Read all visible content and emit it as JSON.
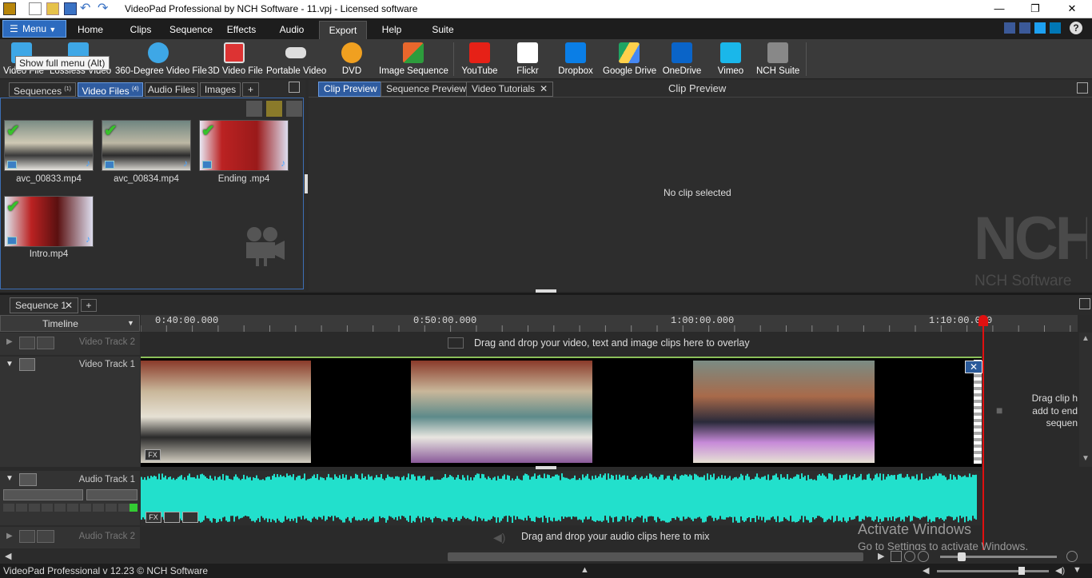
{
  "window": {
    "title": "VideoPad Professional by NCH Software - 11.vpj - Licensed software",
    "minimize": "—",
    "maximize": "❐",
    "close": "✕"
  },
  "menu": {
    "menu_button": "Menu",
    "tabs": [
      "Home",
      "Clips",
      "Sequence",
      "Effects",
      "Audio",
      "Export",
      "Help",
      "Suite"
    ],
    "active_tab": "Export"
  },
  "toolbar": {
    "tooltip": "Show full menu (Alt)",
    "items": [
      {
        "label": "Video File",
        "icon": "video-file-icon",
        "color": "#3ea7e6"
      },
      {
        "label": "Lossless Video",
        "icon": "lossless-video-icon",
        "color": "#3ea7e6"
      },
      {
        "label": "360-Degree Video File",
        "icon": "360-video-icon",
        "color": "#3ea7e6"
      },
      {
        "label": "3D Video File",
        "icon": "3d-video-icon",
        "color": "#d33"
      },
      {
        "label": "Portable Video",
        "icon": "portable-video-icon",
        "color": "#ddd"
      },
      {
        "label": "DVD",
        "icon": "dvd-icon",
        "color": "#f0a020"
      },
      {
        "label": "Image Sequence",
        "icon": "image-sequence-icon",
        "color": "#e8672c"
      },
      {
        "label": "YouTube",
        "icon": "youtube-icon",
        "color": "#e62117"
      },
      {
        "label": "Flickr",
        "icon": "flickr-icon",
        "color": "#ffffff"
      },
      {
        "label": "Dropbox",
        "icon": "dropbox-icon",
        "color": "#0a7ee6"
      },
      {
        "label": "Google Drive",
        "icon": "google-drive-icon",
        "color": "#1fa463"
      },
      {
        "label": "OneDrive",
        "icon": "onedrive-icon",
        "color": "#0a64c8"
      },
      {
        "label": "Vimeo",
        "icon": "vimeo-icon",
        "color": "#1ab7ea"
      },
      {
        "label": "NCH Suite",
        "icon": "nch-suite-icon",
        "color": "#888"
      }
    ]
  },
  "bin": {
    "tabs": [
      {
        "label": "Sequences",
        "badge": "(1)"
      },
      {
        "label": "Video Files",
        "badge": "(4)"
      },
      {
        "label": "Audio Files",
        "badge": ""
      },
      {
        "label": "Images",
        "badge": ""
      },
      {
        "label": "+",
        "badge": ""
      }
    ],
    "active_tab": "Video Files",
    "files": [
      "avc_00833.mp4",
      "avc_00834.mp4",
      "Ending .mp4",
      "Intro.mp4"
    ]
  },
  "preview": {
    "tabs": [
      "Clip Preview",
      "Sequence Preview",
      "Video Tutorials"
    ],
    "active_tab": "Clip Preview",
    "title": "Clip Preview",
    "message": "No clip selected",
    "watermark_logo": "NCH",
    "watermark_text": "NCH Software"
  },
  "sequence": {
    "tab": "Sequence 1",
    "add_tab": "+",
    "timeline_label": "Timeline",
    "ruler_labels": [
      "0:40:00.000",
      "0:50:00.000",
      "1:00:00.000",
      "1:10:00.000"
    ],
    "tracks": {
      "video2": "Video Track 2",
      "video1": "Video Track 1",
      "audio1": "Audio Track 1",
      "audio2": "Audio Track 2"
    },
    "overlay_hint": "Drag and drop your video, text and image clips here to overlay",
    "end_hint": [
      "Drag clip h",
      "add to end",
      "sequen"
    ],
    "audio_hint": "Drag and drop your audio clips here to mix",
    "fx_label": "FX"
  },
  "activation": {
    "title": "Activate Windows",
    "subtitle": "Go to Settings to activate Windows."
  },
  "status": {
    "text": "VideoPad Professional v 12.23 © NCH Software"
  },
  "colors": {
    "accent": "#2f5ca0",
    "waveform": "#22e0cc",
    "playhead": "#e01010"
  }
}
